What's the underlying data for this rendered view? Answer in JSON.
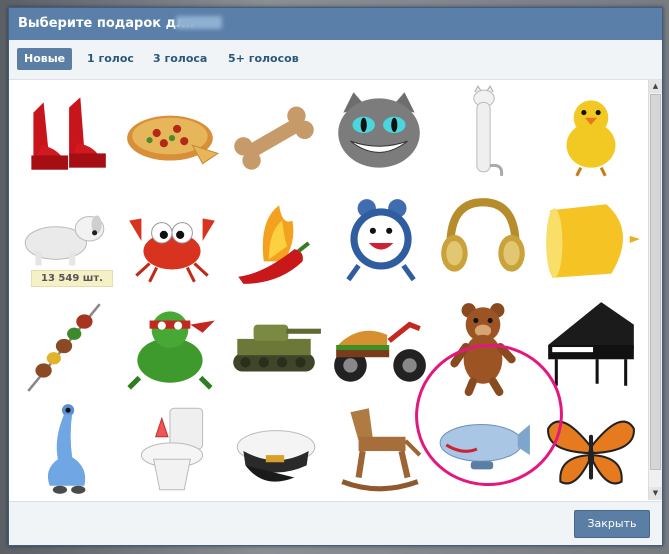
{
  "dialog": {
    "title": "Выберите подарок для"
  },
  "tabs": [
    {
      "label": "Новые",
      "active": true
    },
    {
      "label": "1 голос",
      "active": false
    },
    {
      "label": "3 голоса",
      "active": false
    },
    {
      "label": "5+ голосов",
      "active": false
    }
  ],
  "gifts": [
    {
      "icon": "red-platform-shoes-icon"
    },
    {
      "icon": "pizza-icon"
    },
    {
      "icon": "bone-icon"
    },
    {
      "icon": "cheshire-cat-icon"
    },
    {
      "icon": "long-cat-icon"
    },
    {
      "icon": "yellow-chick-icon"
    },
    {
      "icon": "puppy-icon",
      "count": "13 549 шт."
    },
    {
      "icon": "crab-icon"
    },
    {
      "icon": "chili-pepper-icon"
    },
    {
      "icon": "alarm-clock-icon"
    },
    {
      "icon": "headphones-icon"
    },
    {
      "icon": "lemon-icon"
    },
    {
      "icon": "kebab-skewer-icon"
    },
    {
      "icon": "frog-icon"
    },
    {
      "icon": "tank-icon"
    },
    {
      "icon": "burger-motorcycle-icon"
    },
    {
      "icon": "bear-icon"
    },
    {
      "icon": "grand-piano-icon"
    },
    {
      "icon": "blue-creature-icon"
    },
    {
      "icon": "toilet-icon"
    },
    {
      "icon": "captain-cap-icon"
    },
    {
      "icon": "wooden-horse-icon"
    },
    {
      "icon": "airship-icon"
    },
    {
      "icon": "butterfly-icon"
    }
  ],
  "footer": {
    "close_label": "Закрыть"
  },
  "colors": {
    "titlebar": "#5a7fa8",
    "accent": "#5b7ea5",
    "highlight_circle": "#e4177f"
  }
}
